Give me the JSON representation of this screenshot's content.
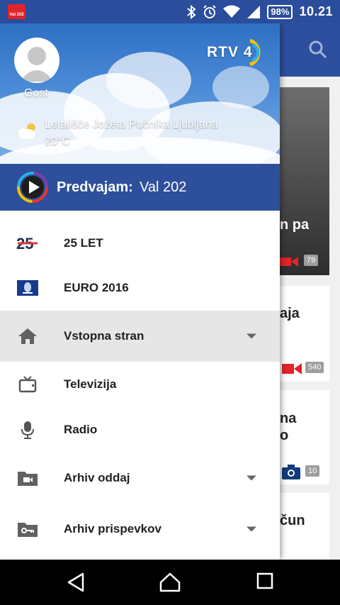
{
  "status_bar": {
    "app_badge": "Val 202",
    "battery": "98%",
    "time": "10.21"
  },
  "drawer": {
    "user_name": "Gost",
    "logo_text": "RTV 4",
    "weather": {
      "location": "Letališče Jožeta Pučnika Ljubljana",
      "temperature": "20°C",
      "icon": "partly-cloudy-icon"
    },
    "now_playing": {
      "label": "Predvajam:",
      "station": "Val 202"
    },
    "menu": [
      {
        "label": "25 LET",
        "icon": "25-years-logo-icon",
        "expandable": false,
        "selected": false
      },
      {
        "label": "EURO 2016",
        "icon": "euro-2016-logo-icon",
        "expandable": false,
        "selected": false
      },
      {
        "label": "Vstopna stran",
        "icon": "home-icon",
        "expandable": true,
        "selected": true
      },
      {
        "label": "Televizija",
        "icon": "tv-icon",
        "expandable": false,
        "selected": false
      },
      {
        "label": "Radio",
        "icon": "microphone-icon",
        "expandable": false,
        "selected": false
      },
      {
        "label": "Arhiv oddaj",
        "icon": "video-folder-icon",
        "expandable": true,
        "selected": false
      },
      {
        "label": "Arhiv prispevkov",
        "icon": "key-folder-icon",
        "expandable": true,
        "selected": false
      }
    ]
  },
  "background": {
    "hero_text": "n pa",
    "hero_count": "79",
    "cards": [
      {
        "text": "aja",
        "count": "540",
        "media": "video-icon"
      },
      {
        "text": "na\no",
        "count": "10",
        "media": "camera-icon"
      },
      {
        "text": "čun",
        "count": "",
        "media": ""
      }
    ]
  },
  "colors": {
    "brand_blue": "#2d4f9c",
    "selected_row": "#e6e6e6",
    "red_accent": "#e0242a"
  }
}
